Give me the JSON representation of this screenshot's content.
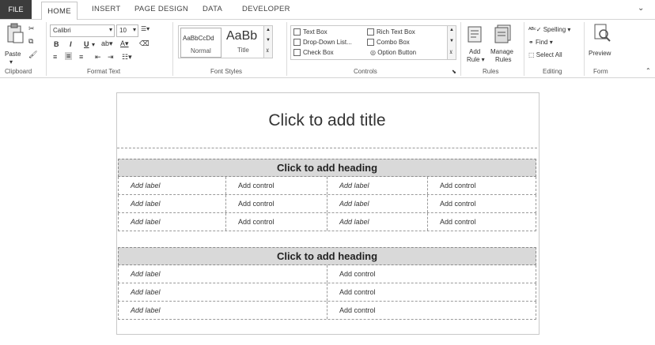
{
  "tabs": {
    "file": "FILE",
    "home": "HOME",
    "insert": "INSERT",
    "page_design": "PAGE DESIGN",
    "data": "DATA",
    "developer": "DEVELOPER"
  },
  "clipboard": {
    "paste": "Paste",
    "group": "Clipboard"
  },
  "format_text": {
    "font": "Calibri",
    "size": "10",
    "bold": "B",
    "italic": "I",
    "underline": "U",
    "group": "Format Text"
  },
  "font_styles": {
    "normal_preview": "AaBbCcDd",
    "normal_label": "Normal",
    "title_preview": "AaBb",
    "title_label": "Title",
    "group": "Font Styles"
  },
  "controls": {
    "text_box": "Text Box",
    "rich_text_box": "Rich Text Box",
    "drop_down_list": "Drop-Down List...",
    "combo_box": "Combo Box",
    "check_box": "Check Box",
    "option_button": "Option Button",
    "group": "Controls"
  },
  "rules": {
    "add_rule_1": "Add",
    "add_rule_2": "Rule",
    "manage_rules_1": "Manage",
    "manage_rules_2": "Rules",
    "group": "Rules"
  },
  "editing": {
    "spelling": "Spelling",
    "find": "Find",
    "select_all": "Select All",
    "group": "Editing"
  },
  "form": {
    "preview": "Preview",
    "group": "Form"
  },
  "document": {
    "title": "Click to add title",
    "heading1": "Click to add heading",
    "heading2": "Click to add heading",
    "section1_rows": [
      [
        "Add label",
        "Add control",
        "Add label",
        "Add control"
      ],
      [
        "Add label",
        "Add control",
        "Add label",
        "Add control"
      ],
      [
        "Add label",
        "Add control",
        "Add label",
        "Add control"
      ]
    ],
    "section2_rows": [
      [
        "Add label",
        "Add control"
      ],
      [
        "Add label",
        "Add control"
      ],
      [
        "Add label",
        "Add control"
      ]
    ]
  },
  "colors": {
    "file_tab": "#3c3c3c",
    "heading_bg": "#d9d9d9"
  }
}
